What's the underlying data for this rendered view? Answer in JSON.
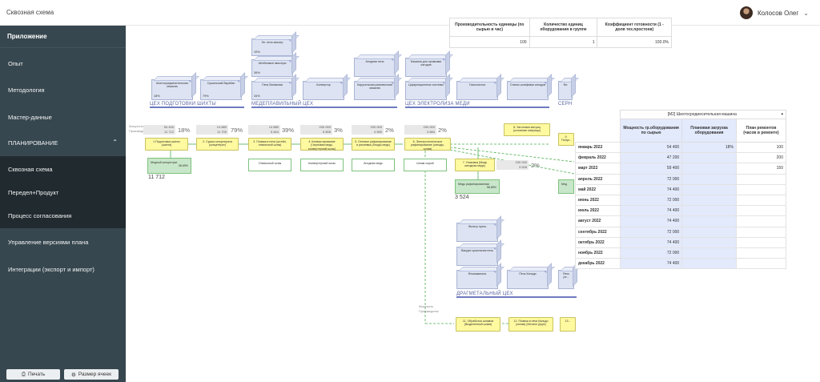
{
  "app": {
    "title": "Сквозная схема"
  },
  "user": {
    "name": "Колосов Олег"
  },
  "sidebar": {
    "header": "Приложение",
    "items": [
      {
        "label": "Опыт"
      },
      {
        "label": "Методология"
      },
      {
        "label": "Мастер-данные"
      },
      {
        "label": "ПЛАНИРОВАНИЕ"
      },
      {
        "label": "Сквозная схема"
      },
      {
        "label": "Передел+Продукт"
      },
      {
        "label": "Процесс согласования"
      },
      {
        "label": "Управление версиями плана"
      },
      {
        "label": "Интеграции (экспорт и импорт)"
      }
    ],
    "print_label": "Печать",
    "cellsize_label": "Размер ячеек"
  },
  "diagram": {
    "shops": [
      {
        "label": "ЦЕХ ПОДГОТОВКИ ШИХТЫ"
      },
      {
        "label": "МЕДЕПЛАВИЛЬНЫЙ ЦЕХ"
      },
      {
        "label": "ЦЕХ ЭЛЕКТРОЛИЗА МЕДИ"
      },
      {
        "label": "СЕРН"
      },
      {
        "label": "ДРАГМЕТАЛЬНЫЙ ЦЕХ"
      }
    ],
    "equipment": [
      {
        "label": "Шихтосредиесительная машина",
        "pct": "18%"
      },
      {
        "label": "Сушильный барабан",
        "pct": "79%"
      },
      {
        "label": "Эл. печь миксер",
        "pct": "10%"
      },
      {
        "label": "Штейновые миксеры",
        "pct": "39%"
      },
      {
        "label": "Печь Ванюкова",
        "pct": "34%"
      },
      {
        "label": "Конвертор",
        "pct": ""
      },
      {
        "label": "Анодная печь",
        "pct": ""
      },
      {
        "label": "Карусельная разливочная машина",
        "pct": ""
      },
      {
        "label": "Машина для промывки катодов",
        "pct": ""
      },
      {
        "label": "Циркуляционные системы",
        "pct": ""
      },
      {
        "label": "Газоочистка",
        "pct": ""
      },
      {
        "label": "Станок шлифовки катодов",
        "pct": ""
      },
      {
        "label": "Фи",
        "pct": ""
      },
      {
        "label": "Фильтр пресс",
        "pct": ""
      },
      {
        "label": "Вакуум сушильная печь",
        "pct": ""
      },
      {
        "label": "Фломакиналь",
        "pct": ""
      },
      {
        "label": "Печь Кальдо",
        "pct": ""
      },
      {
        "label": "Печь ре...",
        "pct": ""
      }
    ],
    "processes": [
      {
        "label": "1.Подготовка шихты (шихта)",
        "top": "54 400",
        "bottom": "11 712",
        "pct": "18%"
      },
      {
        "label": "2. Сушка концентрата (концентрат)",
        "top": "14 880",
        "bottom": "11 700",
        "pct": "79%"
      },
      {
        "label": "3. Плавка в печи (штейн, отвальный шлак)",
        "top": "14 880",
        "bottom": "5 844",
        "pct": "39%"
      },
      {
        "label": "4. Конвертирование (Черновая медь, конвертерный шлак)",
        "top": "200 000",
        "bottom": "5 808",
        "pct": "3%"
      },
      {
        "label": "5. Огневое рафинирование и разливка (Аноды медь)",
        "top": "200 000",
        "bottom": "4 569",
        "pct": "2%"
      },
      {
        "label": "6. Электролитическое рафинирование (катоды, шлам)",
        "top": "200 000",
        "bottom": "3 884",
        "pct": "2%"
      },
      {
        "label": "8. Заготовка матриц (основные матрицы)",
        "top": "",
        "bottom": "",
        "pct": ""
      },
      {
        "label": "7. Упаковка (Медь катодная медь)",
        "top": "200 000",
        "bottom": "3 528",
        "pct": "2%"
      },
      {
        "label": "9. Получ...",
        "top": "",
        "bottom": "",
        "pct": ""
      },
      {
        "label": "11. Обработка шламов (Выделенный шлам)",
        "top": "",
        "bottom": "",
        "pct": ""
      },
      {
        "label": "12. Плавка в печи Кальдо (сплав) (Металл Доре)",
        "top": "",
        "bottom": "",
        "pct": ""
      },
      {
        "label": "13...",
        "top": "",
        "bottom": "",
        "pct": ""
      }
    ],
    "outputs": [
      {
        "label": "Медный концентрат",
        "value": "38.69%"
      },
      {
        "label": "Отвальный шлак"
      },
      {
        "label": "Конвертерный шлак"
      },
      {
        "label": "Анодная медь"
      },
      {
        "label": "Шлам сырой"
      },
      {
        "label": "Медь рафинированная",
        "value": "98.85%"
      },
      {
        "label": "Мед"
      }
    ],
    "bignums": [
      "11 712",
      "3 524"
    ],
    "row_labels": [
      "Мощность",
      "Производство"
    ]
  },
  "table1": {
    "headers": [
      "Производительность единицы (по сырью в час)",
      "Количество единиц оборудования в группе",
      "Коэффициент готовности (1 - доля тех.простоев)"
    ],
    "values": [
      "100",
      "1",
      "100.0%"
    ]
  },
  "table2": {
    "selector": "[М2] Шихтосредиесительная машина",
    "headers": [
      "Мощность гр.оборудования по сырью",
      "Плановая загрузка оборудования",
      "План ремонтов (часов в ремонте)"
    ],
    "rows": [
      {
        "month": "январь 2022",
        "cap": "54 400",
        "load": "18%",
        "rep": "100"
      },
      {
        "month": "февраль 2022",
        "cap": "47 200",
        "load": "",
        "rep": "200"
      },
      {
        "month": "март 2022",
        "cap": "59 400",
        "load": "",
        "rep": "150"
      },
      {
        "month": "апрель 2022",
        "cap": "72 000",
        "load": "",
        "rep": ""
      },
      {
        "month": "май 2022",
        "cap": "74 400",
        "load": "",
        "rep": ""
      },
      {
        "month": "июнь 2022",
        "cap": "72 000",
        "load": "",
        "rep": ""
      },
      {
        "month": "июль 2022",
        "cap": "74 400",
        "load": "",
        "rep": ""
      },
      {
        "month": "август 2022",
        "cap": "74 400",
        "load": "",
        "rep": ""
      },
      {
        "month": "сентябрь 2022",
        "cap": "72 000",
        "load": "",
        "rep": ""
      },
      {
        "month": "октябрь 2022",
        "cap": "74 400",
        "load": "",
        "rep": ""
      },
      {
        "month": "ноябрь 2022",
        "cap": "72 000",
        "load": "",
        "rep": ""
      },
      {
        "month": "декабрь 2022",
        "cap": "74 400",
        "load": "",
        "rep": ""
      }
    ]
  },
  "colors": {
    "sidebar": "#37474f",
    "accent": "#6e7bbf",
    "process": "#fff9a0",
    "output": "#c8e6c9"
  }
}
